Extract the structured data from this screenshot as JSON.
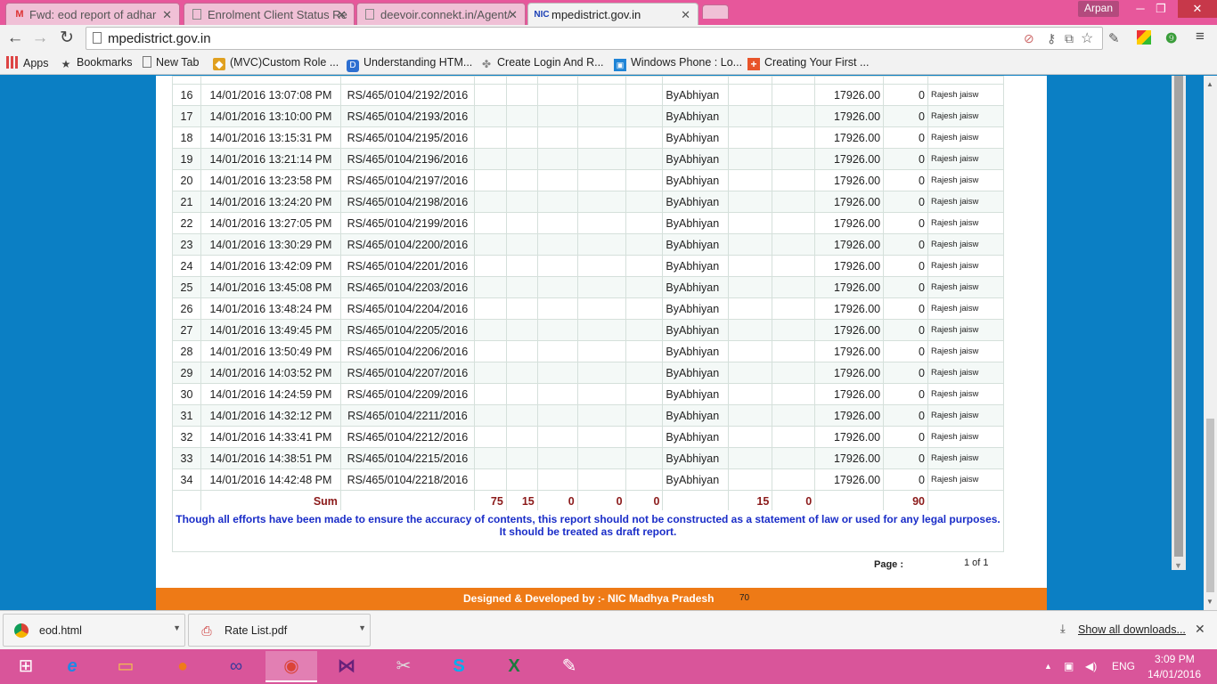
{
  "browser": {
    "tabs": [
      {
        "title": "Fwd: eod report of adhar",
        "icon": "gmail-icon"
      },
      {
        "title": "Enrolment Client Status Re",
        "icon": "page-icon"
      },
      {
        "title": "deevoir.connekt.in/Agent/",
        "icon": "page-icon"
      },
      {
        "title": "mpedistrict.gov.in",
        "icon": "nic-icon",
        "icon_text": "NIC"
      }
    ],
    "profile_name": "Arpan",
    "url": "mpedistrict.gov.in",
    "bookmarks": [
      {
        "label": "Apps",
        "icon": "apps-grid-icon"
      },
      {
        "label": "Bookmarks",
        "icon": "star-icon"
      },
      {
        "label": "New Tab",
        "icon": "page-icon"
      },
      {
        "label": "(MVC)Custom Role ...",
        "icon": "site-icon"
      },
      {
        "label": "Understanding HTM...",
        "icon": "site-icon"
      },
      {
        "label": "Create Login And R...",
        "icon": "site-icon"
      },
      {
        "label": "Windows Phone : Lo...",
        "icon": "windows-icon"
      },
      {
        "label": "Creating Your First ...",
        "icon": "plus-icon"
      }
    ]
  },
  "report": {
    "rows": [
      {
        "n": "16",
        "date": "14/01/2016 13:07:08 PM",
        "id": "RS/465/0104/2192/2016",
        "by": "ByAbhiyan",
        "amount": "17926.00",
        "zero": "0",
        "user": "Rajesh jaisw"
      },
      {
        "n": "17",
        "date": "14/01/2016 13:10:00 PM",
        "id": "RS/465/0104/2193/2016",
        "by": "ByAbhiyan",
        "amount": "17926.00",
        "zero": "0",
        "user": "Rajesh jaisw"
      },
      {
        "n": "18",
        "date": "14/01/2016 13:15:31 PM",
        "id": "RS/465/0104/2195/2016",
        "by": "ByAbhiyan",
        "amount": "17926.00",
        "zero": "0",
        "user": "Rajesh jaisw"
      },
      {
        "n": "19",
        "date": "14/01/2016 13:21:14 PM",
        "id": "RS/465/0104/2196/2016",
        "by": "ByAbhiyan",
        "amount": "17926.00",
        "zero": "0",
        "user": "Rajesh jaisw"
      },
      {
        "n": "20",
        "date": "14/01/2016 13:23:58 PM",
        "id": "RS/465/0104/2197/2016",
        "by": "ByAbhiyan",
        "amount": "17926.00",
        "zero": "0",
        "user": "Rajesh jaisw"
      },
      {
        "n": "21",
        "date": "14/01/2016 13:24:20 PM",
        "id": "RS/465/0104/2198/2016",
        "by": "ByAbhiyan",
        "amount": "17926.00",
        "zero": "0",
        "user": "Rajesh jaisw"
      },
      {
        "n": "22",
        "date": "14/01/2016 13:27:05 PM",
        "id": "RS/465/0104/2199/2016",
        "by": "ByAbhiyan",
        "amount": "17926.00",
        "zero": "0",
        "user": "Rajesh jaisw"
      },
      {
        "n": "23",
        "date": "14/01/2016 13:30:29 PM",
        "id": "RS/465/0104/2200/2016",
        "by": "ByAbhiyan",
        "amount": "17926.00",
        "zero": "0",
        "user": "Rajesh jaisw"
      },
      {
        "n": "24",
        "date": "14/01/2016 13:42:09 PM",
        "id": "RS/465/0104/2201/2016",
        "by": "ByAbhiyan",
        "amount": "17926.00",
        "zero": "0",
        "user": "Rajesh jaisw"
      },
      {
        "n": "25",
        "date": "14/01/2016 13:45:08 PM",
        "id": "RS/465/0104/2203/2016",
        "by": "ByAbhiyan",
        "amount": "17926.00",
        "zero": "0",
        "user": "Rajesh jaisw"
      },
      {
        "n": "26",
        "date": "14/01/2016 13:48:24 PM",
        "id": "RS/465/0104/2204/2016",
        "by": "ByAbhiyan",
        "amount": "17926.00",
        "zero": "0",
        "user": "Rajesh jaisw"
      },
      {
        "n": "27",
        "date": "14/01/2016 13:49:45 PM",
        "id": "RS/465/0104/2205/2016",
        "by": "ByAbhiyan",
        "amount": "17926.00",
        "zero": "0",
        "user": "Rajesh jaisw"
      },
      {
        "n": "28",
        "date": "14/01/2016 13:50:49 PM",
        "id": "RS/465/0104/2206/2016",
        "by": "ByAbhiyan",
        "amount": "17926.00",
        "zero": "0",
        "user": "Rajesh jaisw"
      },
      {
        "n": "29",
        "date": "14/01/2016 14:03:52 PM",
        "id": "RS/465/0104/2207/2016",
        "by": "ByAbhiyan",
        "amount": "17926.00",
        "zero": "0",
        "user": "Rajesh jaisw"
      },
      {
        "n": "30",
        "date": "14/01/2016 14:24:59 PM",
        "id": "RS/465/0104/2209/2016",
        "by": "ByAbhiyan",
        "amount": "17926.00",
        "zero": "0",
        "user": "Rajesh jaisw"
      },
      {
        "n": "31",
        "date": "14/01/2016 14:32:12 PM",
        "id": "RS/465/0104/2211/2016",
        "by": "ByAbhiyan",
        "amount": "17926.00",
        "zero": "0",
        "user": "Rajesh jaisw"
      },
      {
        "n": "32",
        "date": "14/01/2016 14:33:41 PM",
        "id": "RS/465/0104/2212/2016",
        "by": "ByAbhiyan",
        "amount": "17926.00",
        "zero": "0",
        "user": "Rajesh jaisw"
      },
      {
        "n": "33",
        "date": "14/01/2016 14:38:51 PM",
        "id": "RS/465/0104/2215/2016",
        "by": "ByAbhiyan",
        "amount": "17926.00",
        "zero": "0",
        "user": "Rajesh jaisw"
      },
      {
        "n": "34",
        "date": "14/01/2016 14:42:48 PM",
        "id": "RS/465/0104/2218/2016",
        "by": "ByAbhiyan",
        "amount": "17926.00",
        "zero": "0",
        "user": "Rajesh jaisw"
      }
    ],
    "sum": {
      "label": "Sum",
      "c1": "75",
      "c2": "15",
      "c3": "0",
      "c4": "0",
      "c5": "0",
      "c6": "15",
      "c7": "0",
      "c8": "90"
    },
    "disclaimer_line1": "Though all efforts have been made to ensure the accuracy of contents, this report should not be  constructed as a statement of law or used for any legal purposes.",
    "disclaimer_line2": "It should be treated as draft report.",
    "page_label": "Page :",
    "page_value": "1 of 1",
    "footer_text": "Designed & Developed by :- NIC Madhya Pradesh",
    "footer_count": "70"
  },
  "downloads": {
    "items": [
      {
        "name": "eod.html",
        "icon": "chrome-icon"
      },
      {
        "name": "Rate List.pdf",
        "icon": "pdf-icon"
      }
    ],
    "show_all": "Show all downloads..."
  },
  "taskbar": {
    "apps": [
      "start-icon",
      "internet-explorer-icon",
      "file-explorer-icon",
      "firefox-icon",
      "infinity-icon",
      "chrome-icon",
      "visual-studio-icon",
      "snipping-tool-icon",
      "skype-icon",
      "excel-icon",
      "paint-icon"
    ],
    "lang": "ENG",
    "time": "3:09 PM",
    "date": "14/01/2016"
  },
  "colors": {
    "accent_pink": "#e7579b",
    "page_blue": "#0b7fc4",
    "footer_orange": "#ee7a16",
    "sum_red": "#8b1a1a",
    "disclaimer_blue": "#1a2dc8"
  }
}
